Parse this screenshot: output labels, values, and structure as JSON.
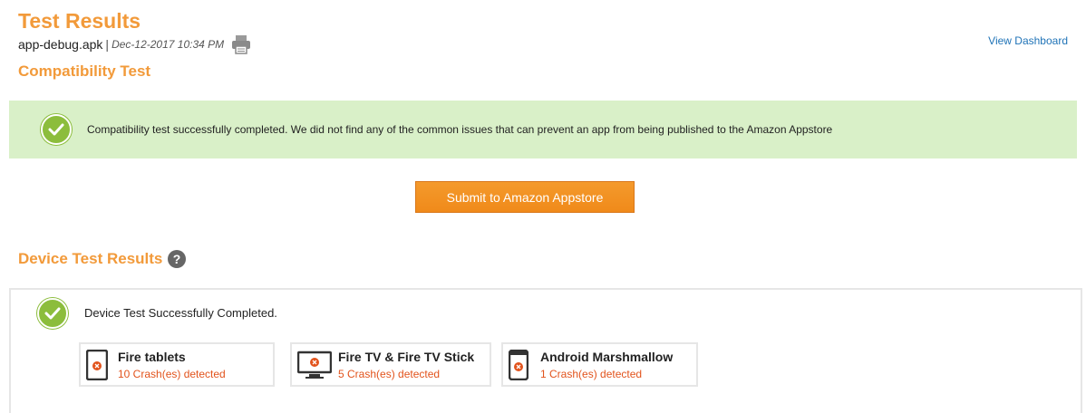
{
  "header": {
    "title": "Test Results",
    "file_name": "app-debug.apk",
    "separator": "|",
    "date": "Dec-12-2017 10:34 PM",
    "view_dashboard_label": "View Dashboard"
  },
  "compatibility": {
    "title": "Compatibility Test",
    "message": "Compatibility test successfully completed. We did not find any of the common issues that can prevent an app from being published to the Amazon Appstore",
    "submit_label": "Submit to Amazon Appstore"
  },
  "device_tests": {
    "title": "Device Test Results",
    "help_glyph": "?",
    "status": "Device Test Successfully Completed.",
    "devices": [
      {
        "name": "Fire tablets",
        "crashes": "10 Crash(es) detected",
        "icon": "tablet-icon"
      },
      {
        "name": "Fire TV & Fire TV Stick",
        "crashes": "5 Crash(es) detected",
        "icon": "tv-icon"
      },
      {
        "name": "Android Marshmallow",
        "crashes": "1 Crash(es) detected",
        "icon": "phone-icon"
      }
    ]
  },
  "colors": {
    "accent_orange": "#f29a3a",
    "success_green": "#8cbd3c",
    "banner_bg": "#d9f0c8",
    "crash_red": "#e2531c",
    "link_blue": "#1f73b7"
  }
}
